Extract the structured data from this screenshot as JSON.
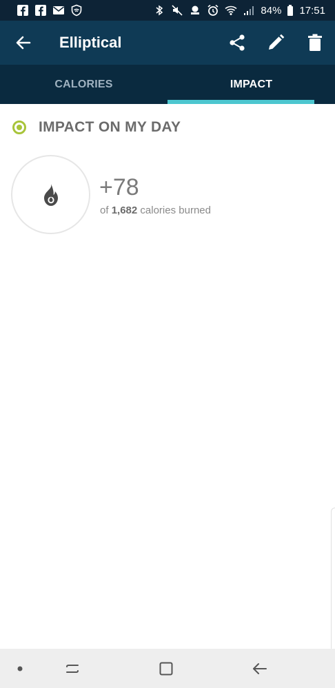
{
  "status_bar": {
    "battery": "84%",
    "time": "17:51"
  },
  "app_bar": {
    "title": "Elliptical",
    "icons": {
      "back": "arrow-left-icon",
      "share": "share-icon",
      "edit": "pencil-icon",
      "delete": "trash-icon"
    }
  },
  "tabs": [
    {
      "label": "CALORIES",
      "selected": false
    },
    {
      "label": "IMPACT",
      "selected": true
    }
  ],
  "impact": {
    "section_title": "IMPACT ON MY DAY",
    "value": "+78",
    "caption_prefix": "of",
    "total": "1,682",
    "caption_suffix": "calories burned",
    "icon": "flame-icon"
  },
  "colors": {
    "status_bar_bg": "#0d2336",
    "app_bar_bg": "#0f3a55",
    "tabs_bg": "#0a2a3f",
    "tab_indicator": "#4cc6cf",
    "accent_green": "#a8c43a"
  }
}
